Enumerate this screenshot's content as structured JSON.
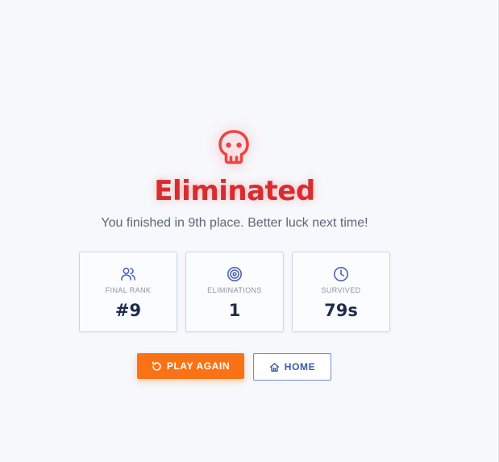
{
  "result": {
    "title": "Eliminated",
    "subtitle": "You finished in 9th place. Better luck next time!",
    "icon": "skull-icon",
    "accent_color": "#d92d2d"
  },
  "stats": [
    {
      "icon": "users-icon",
      "label": "FINAL RANK",
      "value": "#9"
    },
    {
      "icon": "target-icon",
      "label": "ELIMINATIONS",
      "value": "1"
    },
    {
      "icon": "clock-icon",
      "label": "SURVIVED",
      "value": "79s"
    }
  ],
  "actions": {
    "play_again": {
      "label": "PLAY AGAIN",
      "icon": "restart-icon",
      "color": "#f97316"
    },
    "home": {
      "label": "HOME",
      "icon": "home-icon",
      "color": "#3a5aa8"
    }
  }
}
